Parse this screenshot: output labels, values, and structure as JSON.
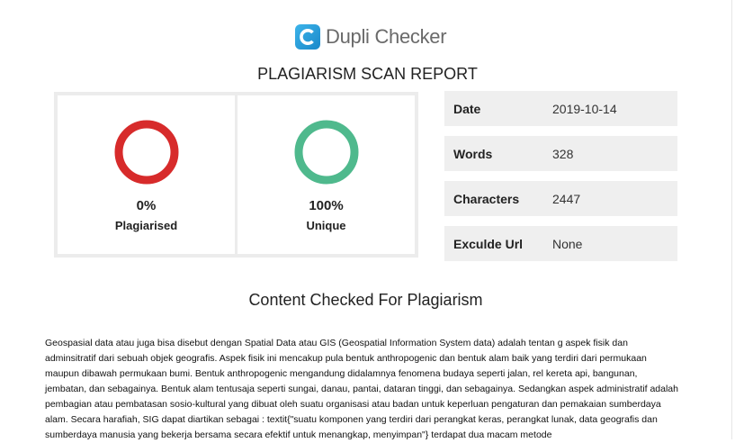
{
  "brand": {
    "name": "Dupli Checker",
    "logo_letter": "C"
  },
  "report_title": "PLAGIARISM SCAN REPORT",
  "scores": [
    {
      "percent": "0%",
      "label": "Plagiarised",
      "color": "#d72b2b",
      "fraction": 0
    },
    {
      "percent": "100%",
      "label": "Unique",
      "color": "#4fb98d",
      "fraction": 1
    }
  ],
  "meta": [
    {
      "key": "Date",
      "value": "2019-10-14"
    },
    {
      "key": "Words",
      "value": "328"
    },
    {
      "key": "Characters",
      "value": "2447"
    },
    {
      "key": "Exculde Url",
      "value": "None"
    }
  ],
  "content_title": "Content Checked For Plagiarism",
  "content_text": "Geospasial data atau juga bisa disebut dengan Spatial Data atau GIS (Geospatial Information System data) adalah tentan g aspek fisik dan adminsitratif dari sebuah objek geografis. Aspek fisik ini mencakup pula bentuk anthropogenic dan bentuk alam baik yang terdiri dari permukaan maupun dibawah permukaan bumi. Bentuk anthropogenic mengandung didalamnya fenomena budaya seperti jalan, rel kereta api, bangunan, jembatan, dan sebagainya. Bentuk alam tentusaja seperti sungai, danau, pantai, dataran tinggi, dan sebagainya. Sedangkan aspek administratif adalah pembagian atau pembatasan sosio-kultural yang dibuat oleh suatu organisasi atau badan untuk keperluan pengaturan dan pemakaian sumberdaya alam. Secara harafiah, SIG dapat diartikan sebagai : textit{\"suatu komponen yang terdiri dari perangkat keras, perangkat lunak, data geografis dan sumberdaya manusia yang bekerja bersama secara efektif untuk menangkap, menyimpan\"} terdapat dua macam metode"
}
